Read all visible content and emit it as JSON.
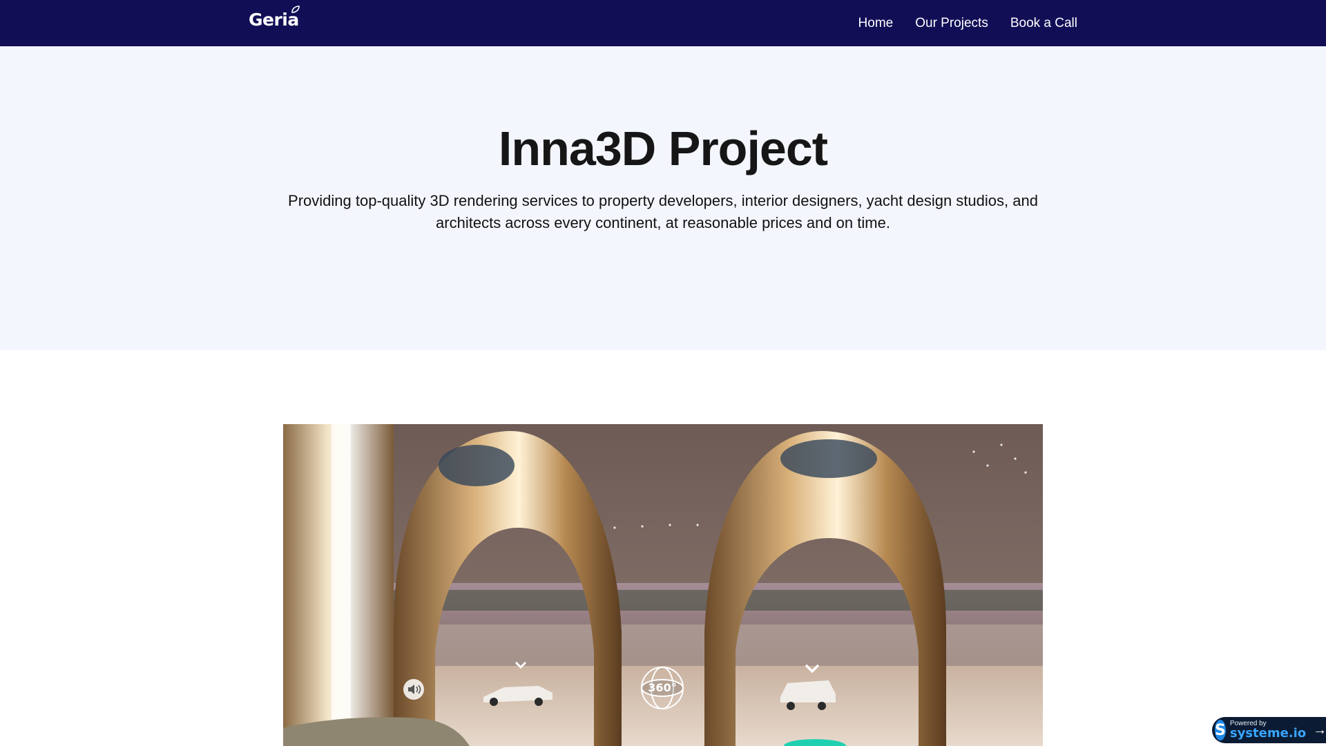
{
  "brand": {
    "name": "Geria"
  },
  "nav": {
    "items": [
      "Home",
      "Our Projects",
      "Book a Call"
    ]
  },
  "hero": {
    "title": "Inna3D Project",
    "description": "Providing top-quality 3D rendering services to property developers, interior designers, yacht design studios, and architects across every continent, at reasonable prices and on time."
  },
  "tour": {
    "view_label": "360°",
    "icons": {
      "sound": "speaker-icon",
      "view": "360-view-icon",
      "hotspot": "chevron-down-icon"
    }
  },
  "badge": {
    "small": "Powered by",
    "big": "systeme.io",
    "icon": "arrow-right-icon"
  },
  "colors": {
    "nav_bg": "#120e56",
    "hero_bg": "#f4f6fe",
    "badge_bg": "#0b1b33",
    "badge_accent": "#38a5ff"
  }
}
